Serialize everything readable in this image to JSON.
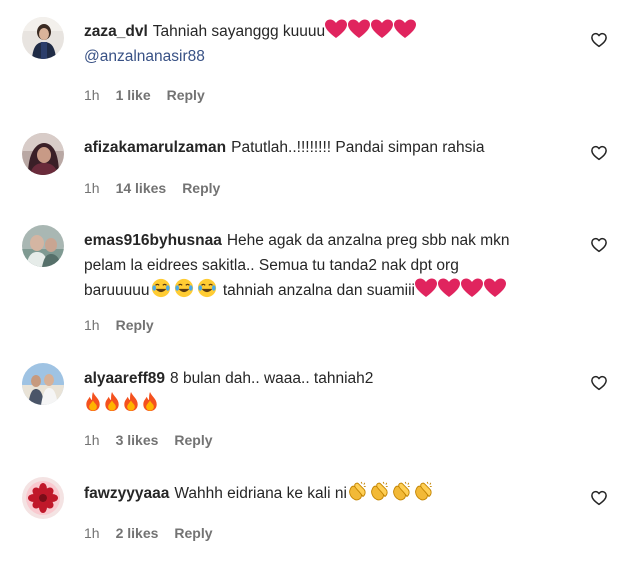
{
  "colors": {
    "text": "#262626",
    "muted": "#737373",
    "mention": "#385185",
    "heart_red": "#e0245e"
  },
  "comments": [
    {
      "username": "zaza_dvl",
      "text": "Tahniah sayanggg kuuuu",
      "emojis": [
        "red-heart",
        "red-heart",
        "red-heart",
        "red-heart"
      ],
      "mention": "@anzalnanasir88",
      "time": "1h",
      "likes": "1 like",
      "reply": "Reply"
    },
    {
      "username": "afizakamarulzaman",
      "text": "Patutlah..!!!!!!!! Pandai simpan rahsia",
      "time": "1h",
      "likes": "14 likes",
      "reply": "Reply"
    },
    {
      "username": "emas916byhusnaa",
      "text_line1": "Hehe agak da anzalna preg sbb nak mkn",
      "text_line2": "pelam la eidrees sakitla.. Semua tu tanda2 nak dpt org",
      "text_line3a": "baruuuuu",
      "emojis_a": [
        "tears-of-joy",
        "tears-of-joy",
        "tears-of-joy"
      ],
      "text_line3b": "tahniah anzalna dan suamiii",
      "emojis_b": [
        "red-heart",
        "red-heart",
        "red-heart",
        "red-heart"
      ],
      "time": "1h",
      "reply": "Reply"
    },
    {
      "username": "alyaareff89",
      "text": "8 bulan dah.. waaa.. tahniah2",
      "emojis": [
        "fire",
        "fire",
        "fire",
        "fire"
      ],
      "time": "1h",
      "likes": "3 likes",
      "reply": "Reply"
    },
    {
      "username": "fawzyyyaaa",
      "text": "Wahhh eidriana ke kali ni",
      "emojis": [
        "clapping-hands",
        "clapping-hands",
        "clapping-hands",
        "clapping-hands"
      ],
      "time": "1h",
      "likes": "2 likes",
      "reply": "Reply"
    }
  ]
}
